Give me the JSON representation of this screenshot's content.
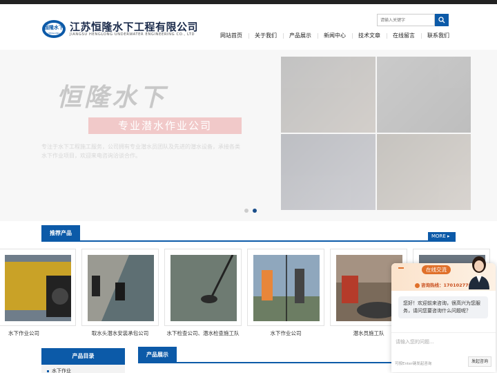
{
  "header": {
    "logo_badge_text": "恒隆水下",
    "logo_badge_sub": "HENGLONG",
    "company_name": "江苏恒隆水下工程有限公司",
    "company_name_en": "JIANGSU HENGLONG UNDERWATER ENGINEERING CO., LTD",
    "search_placeholder": "请输入关键字",
    "nav": [
      "网站首页",
      "关于我们",
      "产品展示",
      "新闻中心",
      "技术文章",
      "在线留言",
      "联系我们"
    ]
  },
  "banner": {
    "title": "恒隆水下",
    "subtitle": "专业潜水作业公司",
    "description": "专注于水下工程施工服务，公司拥有专业潜水员团队及先进的潜水设备，承接各类水下作业项目，欢迎来电咨询洽谈合作。"
  },
  "recommend": {
    "title": "推荐产品",
    "more": "MORE ▸",
    "products": [
      {
        "name": "水下作业公司"
      },
      {
        "name": "取水头潜水安装承包公司"
      },
      {
        "name": "水下检查公司、潜水检查施工队"
      },
      {
        "name": "水下作业公司"
      },
      {
        "name": "潜水员施工队"
      }
    ]
  },
  "catalog": {
    "title": "产品目录",
    "items": [
      "水下作业"
    ]
  },
  "showcase": {
    "title": "产品展示"
  },
  "chat": {
    "title": "在线交流",
    "hotline": "咨询热线：17010277886",
    "greeting": "您好！欢迎前来咨询，很高兴为您服务，请问您要咨询什么问题呢？",
    "input_placeholder": "请输入您的问题...",
    "hint": "可按Enter键发起咨询",
    "send_label": "发起咨询"
  },
  "colors": {
    "brand_blue": "#0c5aa8",
    "chat_orange": "#e0702a"
  }
}
